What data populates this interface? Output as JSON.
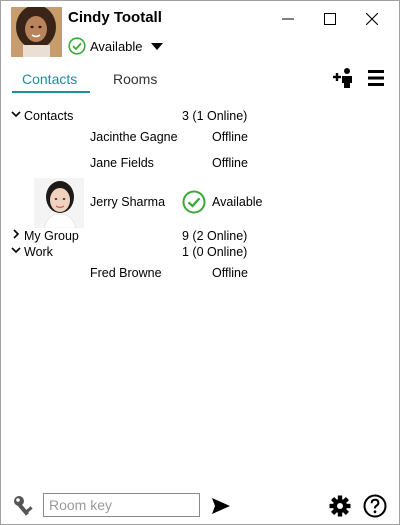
{
  "user": {
    "name": "Cindy Tootall",
    "status": "Available"
  },
  "window_controls": [
    "minimize",
    "maximize",
    "close"
  ],
  "tabs": [
    {
      "label": "Contacts",
      "active": true
    },
    {
      "label": "Rooms",
      "active": false
    }
  ],
  "groups": [
    {
      "name": "Contacts",
      "count": "3 (1 Online)",
      "expanded": true,
      "members": [
        {
          "name": "Jacinthe Gagne",
          "status": "Offline"
        },
        {
          "name": "Jane Fields",
          "status": "Offline"
        },
        {
          "name": "Jerry Sharma",
          "status": "Available"
        }
      ]
    },
    {
      "name": "My Group",
      "count": "9 (2 Online)",
      "expanded": false,
      "members": []
    },
    {
      "name": "Work",
      "count": "1 (0 Online)",
      "expanded": true,
      "members": [
        {
          "name": "Fred Browne",
          "status": "Offline"
        }
      ]
    }
  ],
  "footer": {
    "room_key_placeholder": "Room key"
  },
  "colors": {
    "accent": "#1a8fa0",
    "available": "#3aa83a"
  },
  "icons": [
    "key-icon",
    "send-icon",
    "gear-icon",
    "help-icon",
    "add-contact-icon",
    "menu-icon",
    "check-icon",
    "chevron-down-icon"
  ]
}
